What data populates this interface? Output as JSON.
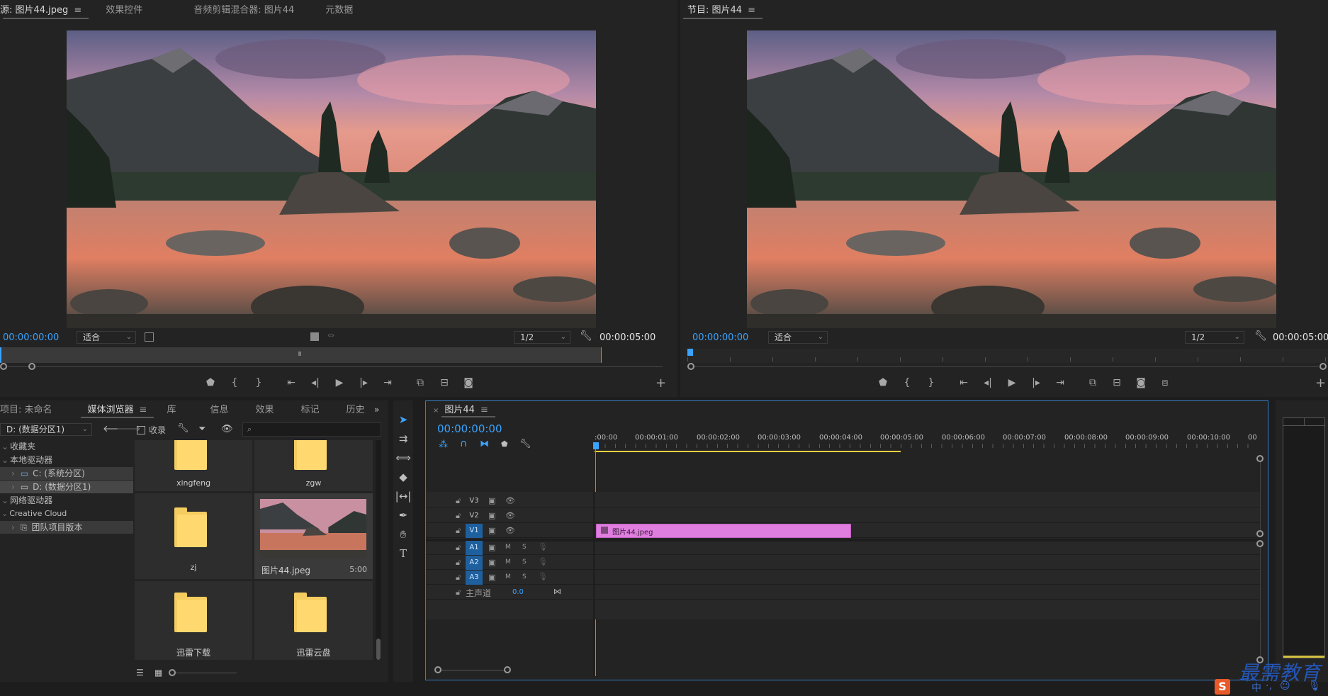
{
  "source_monitor": {
    "tabs": [
      "源: 图片44.jpeg",
      "效果控件",
      "音频剪辑混合器: 图片44",
      "元数据"
    ],
    "timecode_current": "00:00:00:00",
    "fit": "适合",
    "resolution": "1/2",
    "timecode_duration": "00:00:05:00"
  },
  "program_monitor": {
    "tab": "节目: 图片44",
    "timecode_current": "00:00:00:00",
    "fit": "适合",
    "resolution": "1/2",
    "timecode_duration": "00:00:05:00"
  },
  "project_panel": {
    "tabs": [
      "项目: 未命名",
      "媒体浏览器",
      "库",
      "信息",
      "效果",
      "标记",
      "历史"
    ],
    "drive_select": "D: (数据分区1)",
    "ingest_label": "收录",
    "search_placeholder": "",
    "tree": [
      {
        "label": "收藏夹",
        "level": 0
      },
      {
        "label": "本地驱动器",
        "level": 0
      },
      {
        "label": "C: (系统分区)",
        "level": 1
      },
      {
        "label": "D: (数据分区1)",
        "level": 1
      },
      {
        "label": "网络驱动器",
        "level": 0
      },
      {
        "label": "Creative Cloud",
        "level": 0
      },
      {
        "label": "团队项目版本",
        "level": 1
      }
    ],
    "grid": [
      {
        "name": "xingfeng",
        "type": "folder"
      },
      {
        "name": "zgw",
        "type": "folder"
      },
      {
        "name": "zj",
        "type": "folder"
      },
      {
        "name": "图片44.jpeg",
        "type": "image",
        "duration": "5:00"
      },
      {
        "name": "迅雷下载",
        "type": "folder"
      },
      {
        "name": "迅雷云盘",
        "type": "folder"
      }
    ]
  },
  "timeline": {
    "tab": "图片44",
    "timecode": "00:00:00:00",
    "ruler_labels": [
      ":00:00",
      "00:00:01:00",
      "00:00:02:00",
      "00:00:03:00",
      "00:00:04:00",
      "00:00:05:00",
      "00:00:06:00",
      "00:00:07:00",
      "00:00:08:00",
      "00:00:09:00",
      "00:00:10:00",
      "00"
    ],
    "video_tracks": [
      "V3",
      "V2",
      "V1"
    ],
    "audio_tracks": [
      "A1",
      "A2",
      "A3"
    ],
    "mute_label": "M",
    "solo_label": "S",
    "master_label": "主声道",
    "master_value": "0.0",
    "clip_name": "图片44.jpeg",
    "clip_color": "#e07ee0"
  },
  "watermark": {
    "text": "最需教育",
    "ime_badge": "S",
    "ime_text": "中"
  },
  "colors": {
    "accent_blue": "#3aa3ff",
    "playhead": "#3aa3ff",
    "work_area": "#e8d040"
  }
}
